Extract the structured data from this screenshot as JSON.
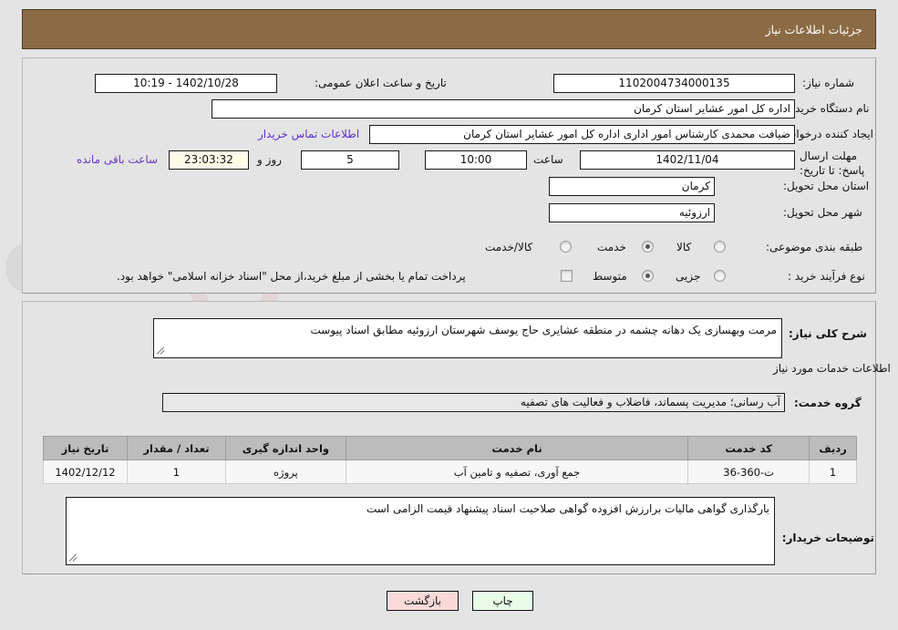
{
  "header": {
    "title": "جزئیات اطلاعات نیاز"
  },
  "colors": {
    "header_bg": "#8b6b43",
    "page_bg": "#e4e4e4",
    "link": "#5b2fd6",
    "countdown_bg": "#fbfbe8",
    "print_btn_bg": "#e9fbe9",
    "back_btn_bg": "#fbd9d9",
    "table_header_bg": "#bcbcbc"
  },
  "form": {
    "need_number": {
      "label": "شماره نیاز:",
      "value": "1102004734000135"
    },
    "announce_datetime": {
      "label": "تاریخ و ساعت اعلان عمومی:",
      "value": "1402/10/28 - 10:19"
    },
    "buyer_org": {
      "label": "نام دستگاه خریدار:",
      "value": "اداره کل امور عشایر استان کرمان"
    },
    "request_creator": {
      "label": "ایجاد کننده درخواست:",
      "value": "ضیافت محمدی کارشناس امور اداری اداره کل امور عشایر استان کرمان"
    },
    "buyer_contact_link": "اطلاعات تماس خریدار",
    "deadline": {
      "label": "مهلت ارسال پاسخ: تا تاریخ:",
      "date": "1402/11/04",
      "time_label": "ساعت",
      "time": "10:00",
      "days": "5",
      "days_label": "روز و",
      "countdown": "23:03:32",
      "countdown_label": "ساعت باقی مانده"
    },
    "delivery_province": {
      "label": "استان محل تحویل:",
      "value": "کرمان"
    },
    "delivery_city": {
      "label": "شهر محل تحویل:",
      "value": "ارزوئیه"
    },
    "subject_category": {
      "label": "طبقه بندی موضوعی:",
      "options": [
        "کالا",
        "خدمت",
        "کالا/خدمت"
      ],
      "selected": "خدمت"
    },
    "purchase_process": {
      "label": "نوع فرآیند خرید :",
      "options": [
        "جزیی",
        "متوسط"
      ],
      "selected": "متوسط"
    },
    "treasury_note": {
      "text": "پرداخت تمام یا بخشی از مبلغ خرید،از محل \"اسناد خزانه اسلامی\" خواهد بود.",
      "checked": false
    },
    "general_description": {
      "label": "شرح کلی نیاز:",
      "value": "مرمت وبهسازی یک دهانه چشمه در منطقه عشایری حاج یوسف شهرستان ارزوئیه مطابق اسناد پیوست"
    },
    "services_section_title": "اطلاعات خدمات مورد نیاز",
    "service_group": {
      "label": "گروه خدمت:",
      "value": "آب رسانی؛ مدیریت پسماند، فاضلاب و فعالیت های تصفیه"
    },
    "buyer_notes": {
      "label": "توضیحات خریدار:",
      "value": "بارگذاری گواهی مالیات برارزش افزوده  گواهی صلاحیت اسناد پیشنهاد قیمت الزامی است"
    }
  },
  "services_table": {
    "columns": [
      "ردیف",
      "کد خدمت",
      "نام خدمت",
      "واحد اندازه گیری",
      "تعداد / مقدار",
      "تاریخ نیاز"
    ],
    "rows": [
      {
        "row": "1",
        "service_code": "ت-360-36",
        "service_name": "جمع آوری، تصفیه و تامین آب",
        "unit": "پروژه",
        "quantity": "1",
        "need_date": "1402/12/12"
      }
    ]
  },
  "footer": {
    "print_label": "چاپ",
    "back_label": "بازگشت"
  },
  "watermark": {
    "text": "AriaTender.net"
  }
}
